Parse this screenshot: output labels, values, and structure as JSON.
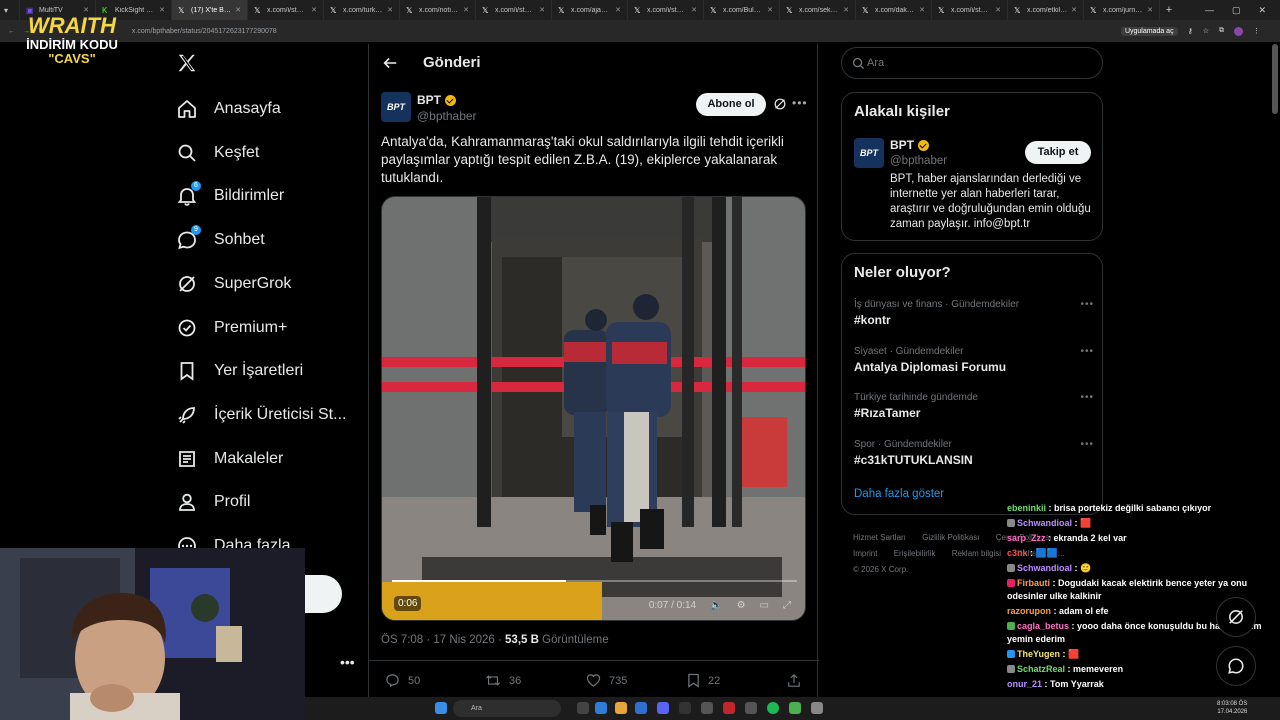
{
  "browser": {
    "tabs": [
      {
        "title": "MultiTV",
        "icon": "tv-icon",
        "color": "#7c4dff"
      },
      {
        "title": "KickSight Link",
        "icon": "kick-icon",
        "color": "#53fc18"
      },
      {
        "title": "(17) X'te BPT",
        "icon": "x-icon",
        "color": "#ffffff",
        "active": true
      },
      {
        "title": "x.com/i/status/",
        "icon": "x-icon",
        "color": "#ffffff"
      },
      {
        "title": "x.com/turkceg",
        "icon": "x-icon",
        "color": "#ffffff"
      },
      {
        "title": "x.com/notifyh",
        "icon": "x-icon",
        "color": "#ffffff"
      },
      {
        "title": "x.com/i/status",
        "icon": "x-icon",
        "color": "#ffffff"
      },
      {
        "title": "x.com/ajansm",
        "icon": "x-icon",
        "color": "#ffffff"
      },
      {
        "title": "x.com/i/status",
        "icon": "x-icon",
        "color": "#ffffff"
      },
      {
        "title": "x.com/Bulvarp",
        "icon": "x-icon",
        "color": "#ffffff"
      },
      {
        "title": "x.com/sekansn",
        "icon": "x-icon",
        "color": "#ffffff"
      },
      {
        "title": "x.com/daktiloc",
        "icon": "x-icon",
        "color": "#ffffff"
      },
      {
        "title": "x.com/i/status",
        "icon": "x-icon",
        "color": "#ffffff"
      },
      {
        "title": "x.com/etkilihal",
        "icon": "x-icon",
        "color": "#ffffff"
      },
      {
        "title": "x.com/jurnalh",
        "icon": "x-icon",
        "color": "#ffffff"
      }
    ],
    "url": "x.com/bpthaber/status/2045172623177290078",
    "app_badge": "Uygulamada aç"
  },
  "overlay": {
    "title": "WRAITH",
    "line1": "İNDİRİM KODU",
    "line2": "\"CAVS\""
  },
  "nav": {
    "items": [
      {
        "label": "Anasayfa",
        "icon": "home-icon"
      },
      {
        "label": "Keşfet",
        "icon": "search-icon"
      },
      {
        "label": "Bildirimler",
        "icon": "bell-icon",
        "badge": "6"
      },
      {
        "label": "Sohbet",
        "icon": "chat-icon",
        "badge": "9"
      },
      {
        "label": "SuperGrok",
        "icon": "grok-icon"
      },
      {
        "label": "Premium+",
        "icon": "premium-icon"
      },
      {
        "label": "Yer İşaretleri",
        "icon": "bookmark-icon"
      },
      {
        "label": "İçerik Üreticisi St...",
        "icon": "rocket-icon"
      },
      {
        "label": "Makaleler",
        "icon": "article-icon"
      },
      {
        "label": "Profil",
        "icon": "profile-icon"
      },
      {
        "label": "Daha fazla",
        "icon": "more-circle-icon"
      }
    ]
  },
  "post": {
    "header": "Gönderi",
    "author_name": "BPT",
    "author_handle": "@bpthaber",
    "avatar_text": "BPT",
    "subscribe_label": "Abone ol",
    "text": "Antalya'da, Kahramanmaraş'taki okul saldırılarıyla ilgili tehdit içerikli paylaşımlar yaptığı tespit edilen Z.B.A. (19), ekiplerce yakalanarak tutuklandı.",
    "video": {
      "remaining": "0:06",
      "position": "0:07",
      "duration": "0:14",
      "progress": 0.43,
      "watermark": "BPT"
    },
    "time": "ÖS 7:08 · 17 Nis 2026",
    "views": "53,5 B",
    "views_label": "Görüntüleme",
    "stats": {
      "replies": "50",
      "reposts": "36",
      "likes": "735",
      "bookmarks": "22"
    }
  },
  "sidebar": {
    "search_placeholder": "Ara",
    "related_title": "Alakalı kişiler",
    "related": {
      "name": "BPT",
      "handle": "@bpthaber",
      "avatar_text": "BPT",
      "follow_label": "Takip et",
      "bio": "BPT, haber ajanslarından derlediği ve internette yer alan haberleri tarar, araştırır ve doğruluğundan emin olduğu zaman paylaşır. info@bpt.tr"
    },
    "trends_title": "Neler oluyor?",
    "trends": [
      {
        "context": "İş dünyası ve finans · Gündemdekiler",
        "name": "#kontr"
      },
      {
        "context": "Siyaset · Gündemdekiler",
        "name": "Antalya Diplomasi Forumu"
      },
      {
        "context": "Türkiye tarihinde gündemde",
        "name": "#RızaTamer"
      },
      {
        "context": "Spor · Gündemdekiler",
        "name": "#c31kTUTUKLANSIN"
      }
    ],
    "show_more": "Daha fazla göster",
    "footer": [
      "Hizmet Şartları",
      "Gizlilik Politikası",
      "Çerez Politikası",
      "Imprint",
      "Erişilebilirlik",
      "Reklam bilgisi",
      "Daha fazla ...",
      "© 2026 X Corp."
    ]
  },
  "chat": [
    {
      "user": "ebeninkii",
      "color": "#6fdc6f",
      "msg": ": brisa portekiz değilki sabancı çıkıyor"
    },
    {
      "user": "Schwandioal",
      "color": "#b98cff",
      "msg": ": 🟥",
      "badge": "#888888"
    },
    {
      "user": "sarp_Zzz",
      "color": "#ff6ec7",
      "msg": ": ekranda 2 kel var"
    },
    {
      "user": "c3nk",
      "color": "#ff4d4d",
      "msg": ": 🟦🟦"
    },
    {
      "user": "Schwandioal",
      "color": "#b98cff",
      "msg": ": 🙂",
      "badge": "#888888"
    },
    {
      "user": "Firbauti",
      "color": "#ff9f40",
      "msg": ": Dogudaki kacak elektirik bence yeter ya onu odesinler ulke kalkinir",
      "badge": "#e91e63"
    },
    {
      "user": "razorupon",
      "color": "#ff9f40",
      "msg": ": adam ol efe"
    },
    {
      "user": "cagla_betus",
      "color": "#ff6ec7",
      "msg": ": yooo daha önce konuşuldu bu hatırlıyorum yemin ederim",
      "badge": "#4caf50"
    },
    {
      "user": "TheYugen",
      "color": "#f5e663",
      "msg": ": 🟥",
      "badge": "#2196f3"
    },
    {
      "user": "SchatzReal",
      "color": "#6fdc6f",
      "msg": ": memeveren",
      "badge": "#888888"
    },
    {
      "user": "onur_21",
      "color": "#b98cff",
      "msg": ": Tom Yyarrak"
    }
  ],
  "taskbar": {
    "search_placeholder": "Ara",
    "time": "8:03:08 ÖS",
    "date": "17.04.2026"
  }
}
